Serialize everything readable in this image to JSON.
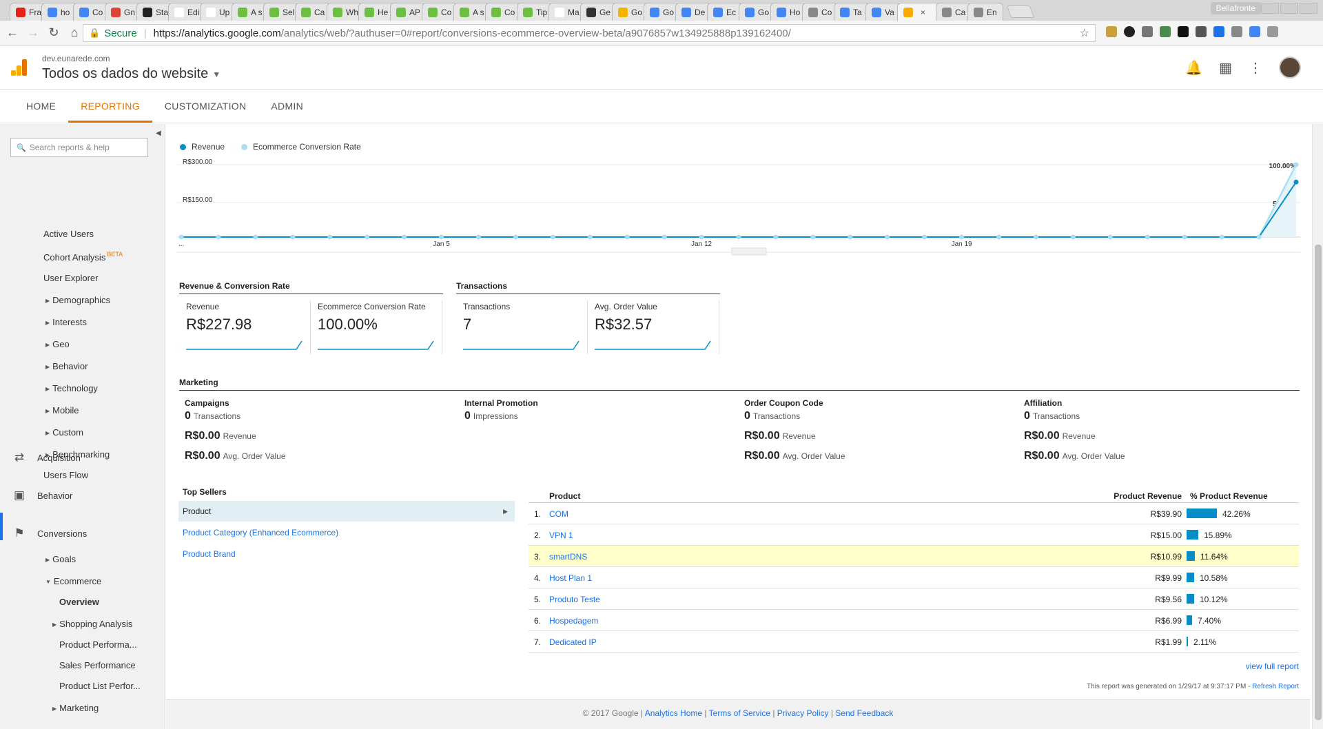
{
  "browser": {
    "tabs": [
      {
        "label": "Fra",
        "color": "#e62117"
      },
      {
        "label": "ho",
        "color": "#4285f4"
      },
      {
        "label": "Co",
        "color": "#4285f4"
      },
      {
        "label": "Gn",
        "color": "#db4437"
      },
      {
        "label": "Sta",
        "color": "#222222"
      },
      {
        "label": "Edi",
        "color": "#ffffff"
      },
      {
        "label": "Up",
        "color": "#ffffff"
      },
      {
        "label": "A s",
        "color": "#6cbf43"
      },
      {
        "label": "Sel",
        "color": "#6cbf43"
      },
      {
        "label": "Ca",
        "color": "#6cbf43"
      },
      {
        "label": "Wh",
        "color": "#6cbf43"
      },
      {
        "label": "He",
        "color": "#6cbf43"
      },
      {
        "label": "AP",
        "color": "#6cbf43"
      },
      {
        "label": "Co",
        "color": "#6cbf43"
      },
      {
        "label": "A s",
        "color": "#6cbf43"
      },
      {
        "label": "Co",
        "color": "#6cbf43"
      },
      {
        "label": "Tip",
        "color": "#6cbf43"
      },
      {
        "label": "Ma",
        "color": "#ffffff"
      },
      {
        "label": "Ge",
        "color": "#333333"
      },
      {
        "label": "Go",
        "color": "#f4b400"
      },
      {
        "label": "Go",
        "color": "#4285f4"
      },
      {
        "label": "De",
        "color": "#4285f4"
      },
      {
        "label": "Ec",
        "color": "#4285f4"
      },
      {
        "label": "Go",
        "color": "#4285f4"
      },
      {
        "label": "Ho",
        "color": "#4285f4"
      },
      {
        "label": "Co",
        "color": "#888888"
      },
      {
        "label": "Ta",
        "color": "#4285f4"
      },
      {
        "label": "Va",
        "color": "#4285f4"
      },
      {
        "label": "",
        "color": "#f9ab00",
        "active": true
      },
      {
        "label": "Ca",
        "color": "#888888"
      },
      {
        "label": "En",
        "color": "#888888"
      }
    ],
    "profile_name": "Bellafronte",
    "secure_label": "Secure",
    "url_host": "https://analytics.google.com",
    "url_rest": "/analytics/web/?authuser=0#report/conversions-ecommerce-overview-beta/a9076857w134925888p139162400/"
  },
  "header": {
    "domain": "dev.eunarede.com",
    "view": "Todos os dados do website"
  },
  "topnav": [
    "HOME",
    "REPORTING",
    "CUSTOMIZATION",
    "ADMIN"
  ],
  "sidebar": {
    "search_placeholder": "Search reports & help",
    "audience_items": [
      {
        "label": "Active Users",
        "tri": false
      },
      {
        "label": "Cohort Analysis",
        "tri": false,
        "beta": "BETA"
      },
      {
        "label": "User Explorer",
        "tri": false
      },
      {
        "label": "Demographics",
        "tri": true
      },
      {
        "label": "Interests",
        "tri": true
      },
      {
        "label": "Geo",
        "tri": true
      },
      {
        "label": "Behavior",
        "tri": true
      },
      {
        "label": "Technology",
        "tri": true
      },
      {
        "label": "Mobile",
        "tri": true
      },
      {
        "label": "Custom",
        "tri": true
      },
      {
        "label": "Benchmarking",
        "tri": true
      },
      {
        "label": "Users Flow",
        "tri": false
      }
    ],
    "sections": {
      "acquisition": "Acquisition",
      "behavior": "Behavior",
      "conversions": "Conversions"
    },
    "conversions_items": {
      "goals": "Goals",
      "ecommerce": "Ecommerce",
      "overview": "Overview",
      "shopping_analysis": "Shopping Analysis",
      "product_performance": "Product Performa...",
      "sales_performance": "Sales Performance",
      "product_list": "Product List Perfor...",
      "marketing": "Marketing"
    }
  },
  "chart_data": {
    "type": "line",
    "legend": [
      {
        "name": "Revenue",
        "color": "#058dc7"
      },
      {
        "name": "Ecommerce Conversion Rate",
        "color": "#aadff3"
      }
    ],
    "x_tick_labels": [
      "...",
      "Jan 5",
      "Jan 12",
      "Jan 19"
    ],
    "left_axis_ticks": [
      "R$300.00",
      "R$150.00"
    ],
    "right_axis_ticks": [
      "100.00%",
      "50.00%"
    ],
    "left_ylim": [
      0,
      300
    ],
    "right_ylim": [
      0,
      100
    ],
    "points": 31,
    "series": [
      {
        "name": "Revenue",
        "values": [
          0,
          0,
          0,
          0,
          0,
          0,
          0,
          0,
          0,
          0,
          0,
          0,
          0,
          0,
          0,
          0,
          0,
          0,
          0,
          0,
          0,
          0,
          0,
          0,
          0,
          0,
          0,
          0,
          0,
          0,
          227.98
        ]
      },
      {
        "name": "Ecommerce Conversion Rate",
        "values": [
          0,
          0,
          0,
          0,
          0,
          0,
          0,
          0,
          0,
          0,
          0,
          0,
          0,
          0,
          0,
          0,
          0,
          0,
          0,
          0,
          0,
          0,
          0,
          0,
          0,
          0,
          0,
          0,
          0,
          0,
          100
        ]
      }
    ]
  },
  "metrics": {
    "rev_conv_title": "Revenue & Conversion Rate",
    "transactions_title": "Transactions",
    "revenue_label": "Revenue",
    "revenue_value": "R$227.98",
    "conv_label": "Ecommerce Conversion Rate",
    "conv_value": "100.00%",
    "trans_label": "Transactions",
    "trans_value": "7",
    "aov_label": "Avg. Order Value",
    "aov_value": "R$32.57"
  },
  "marketing": {
    "title": "Marketing",
    "campaigns": {
      "label": "Campaigns",
      "transactions": "0",
      "trans_unit": "Transactions",
      "revenue": "R$0.00",
      "rev_unit": "Revenue",
      "aov": "R$0.00",
      "aov_unit": "Avg. Order Value"
    },
    "internal": {
      "label": "Internal Promotion",
      "impressions": "0",
      "imp_unit": "Impressions"
    },
    "coupon": {
      "label": "Order Coupon Code",
      "transactions": "0",
      "trans_unit": "Transactions",
      "revenue": "R$0.00",
      "rev_unit": "Revenue",
      "aov": "R$0.00",
      "aov_unit": "Avg. Order Value"
    },
    "affiliation": {
      "label": "Affiliation",
      "transactions": "0",
      "trans_unit": "Transactions",
      "revenue": "R$0.00",
      "rev_unit": "Revenue",
      "aov": "R$0.00",
      "aov_unit": "Avg. Order Value"
    }
  },
  "top_sellers": {
    "title": "Top Sellers",
    "items": [
      "Product",
      "Product Category (Enhanced Ecommerce)",
      "Product Brand"
    ]
  },
  "products": {
    "col_product": "Product",
    "col_revenue": "Product Revenue",
    "col_pct": "% Product Revenue",
    "rows": [
      {
        "num": "1.",
        "name": "COM",
        "revenue": "R$39.90",
        "pct": "42.26%",
        "share": 42.26
      },
      {
        "num": "2.",
        "name": "VPN 1",
        "revenue": "R$15.00",
        "pct": "15.89%",
        "share": 15.89
      },
      {
        "num": "3.",
        "name": "smartDNS",
        "revenue": "R$10.99",
        "pct": "11.64%",
        "share": 11.64
      },
      {
        "num": "4.",
        "name": "Host Plan 1",
        "revenue": "R$9.99",
        "pct": "10.58%",
        "share": 10.58
      },
      {
        "num": "5.",
        "name": "Produto Teste",
        "revenue": "R$9.56",
        "pct": "10.12%",
        "share": 10.12
      },
      {
        "num": "6.",
        "name": "Hospedagem",
        "revenue": "R$6.99",
        "pct": "7.40%",
        "share": 7.4
      },
      {
        "num": "7.",
        "name": "Dedicated IP",
        "revenue": "R$1.99",
        "pct": "2.11%",
        "share": 2.11
      }
    ],
    "view_full": "view full report"
  },
  "report_footer": {
    "generated": "This report was generated on 1/29/17 at 9:37:17 PM - ",
    "refresh": "Refresh Report"
  },
  "footer": {
    "copyright": "© 2017 Google | ",
    "links": [
      "Analytics Home",
      "Terms of Service",
      "Privacy Policy",
      "Send Feedback"
    ]
  }
}
